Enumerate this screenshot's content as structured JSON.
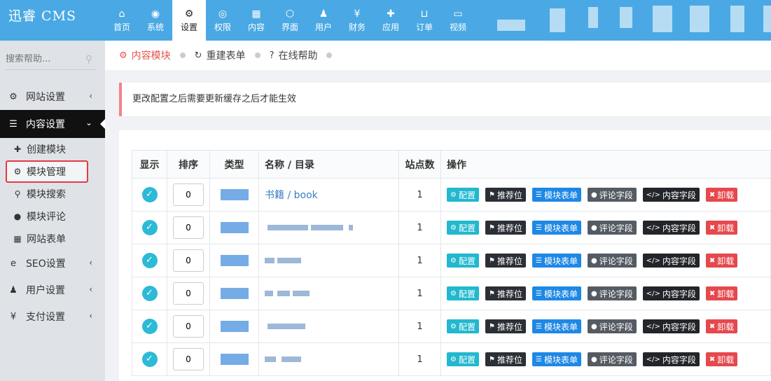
{
  "brand": "迅睿 CMS",
  "nav": [
    {
      "label": "首页",
      "icon": "home-icon",
      "glyph": "⌂",
      "active": false
    },
    {
      "label": "系统",
      "icon": "globe-icon",
      "glyph": "◉",
      "active": false
    },
    {
      "label": "设置",
      "icon": "cogs-icon",
      "glyph": "⚙",
      "active": true
    },
    {
      "label": "权限",
      "icon": "user-circle-icon",
      "glyph": "◎",
      "active": false
    },
    {
      "label": "内容",
      "icon": "grid-icon",
      "glyph": "▦",
      "active": false
    },
    {
      "label": "界面",
      "icon": "html5-icon",
      "glyph": "⬡",
      "active": false
    },
    {
      "label": "用户",
      "icon": "user-icon",
      "glyph": "♟",
      "active": false
    },
    {
      "label": "财务",
      "icon": "yen-icon",
      "glyph": "¥",
      "active": false
    },
    {
      "label": "应用",
      "icon": "puzzle-icon",
      "glyph": "✚",
      "active": false
    },
    {
      "label": "订单",
      "icon": "cart-icon",
      "glyph": "⊔",
      "active": false
    },
    {
      "label": "视频",
      "icon": "video-icon",
      "glyph": "▭",
      "active": false
    }
  ],
  "search": {
    "placeholder": "搜索帮助..."
  },
  "sidebar": {
    "sections": [
      {
        "label": "网站设置",
        "glyph": "⚙",
        "icon": "gear-icon",
        "chev": "‹"
      },
      {
        "label": "内容设置",
        "glyph": "☰",
        "icon": "bars-icon",
        "chev": "⌄"
      }
    ],
    "subs": [
      {
        "label": "创建模块",
        "glyph": "✚",
        "icon": "plus-icon"
      },
      {
        "label": "模块管理",
        "glyph": "⚙",
        "icon": "cogs-icon"
      },
      {
        "label": "模块搜索",
        "glyph": "⚲",
        "icon": "search-icon"
      },
      {
        "label": "模块评论",
        "glyph": "●",
        "icon": "comments-icon"
      },
      {
        "label": "网站表单",
        "glyph": "▦",
        "icon": "table-icon"
      }
    ],
    "more": [
      {
        "label": "SEO设置",
        "glyph": "e",
        "icon": "ie-icon",
        "chev": "‹"
      },
      {
        "label": "用户设置",
        "glyph": "♟",
        "icon": "user-icon",
        "chev": "‹"
      },
      {
        "label": "支付设置",
        "glyph": "¥",
        "icon": "yen-icon",
        "chev": "‹"
      }
    ]
  },
  "tabs": [
    {
      "label": "内容模块",
      "glyph": "⚙",
      "icon": "cogs-icon",
      "active": true
    },
    {
      "label": "重建表单",
      "glyph": "↻",
      "icon": "refresh-icon",
      "active": false
    },
    {
      "label": "在线帮助",
      "glyph": "?",
      "icon": "question-circle-icon",
      "active": false
    }
  ],
  "notice": "更改配置之后需要更新缓存之后才能生效",
  "table": {
    "headers": [
      "显示",
      "排序",
      "类型",
      "名称 / 目录",
      "站点数",
      "操作"
    ],
    "rows": [
      {
        "order": "0",
        "name": "书籍 / book",
        "sites": "1"
      },
      {
        "order": "0",
        "name": "",
        "sites": "1"
      },
      {
        "order": "0",
        "name": "",
        "sites": "1"
      },
      {
        "order": "0",
        "name": "",
        "sites": "1"
      },
      {
        "order": "0",
        "name": "",
        "sites": "1"
      },
      {
        "order": "0",
        "name": "",
        "sites": "1"
      }
    ],
    "actions": [
      {
        "label": "配置",
        "glyph": "⚙",
        "icon": "gear-icon",
        "cls": "b-config"
      },
      {
        "label": "推荐位",
        "glyph": "⚑",
        "icon": "flag-icon",
        "cls": "b-rec"
      },
      {
        "label": "模块表单",
        "glyph": "☰",
        "icon": "list-icon",
        "cls": "b-form"
      },
      {
        "label": "评论字段",
        "glyph": "●",
        "icon": "comment-icon",
        "cls": "b-comment"
      },
      {
        "label": "内容字段",
        "glyph": "</>",
        "icon": "code-icon",
        "cls": "b-field"
      },
      {
        "label": "卸载",
        "glyph": "✖",
        "icon": "trash-icon",
        "cls": "b-uninstall"
      }
    ]
  },
  "colors": {
    "topbar": "#4aa9e4",
    "accent": "#e5534b",
    "check": "#2cbad6"
  }
}
